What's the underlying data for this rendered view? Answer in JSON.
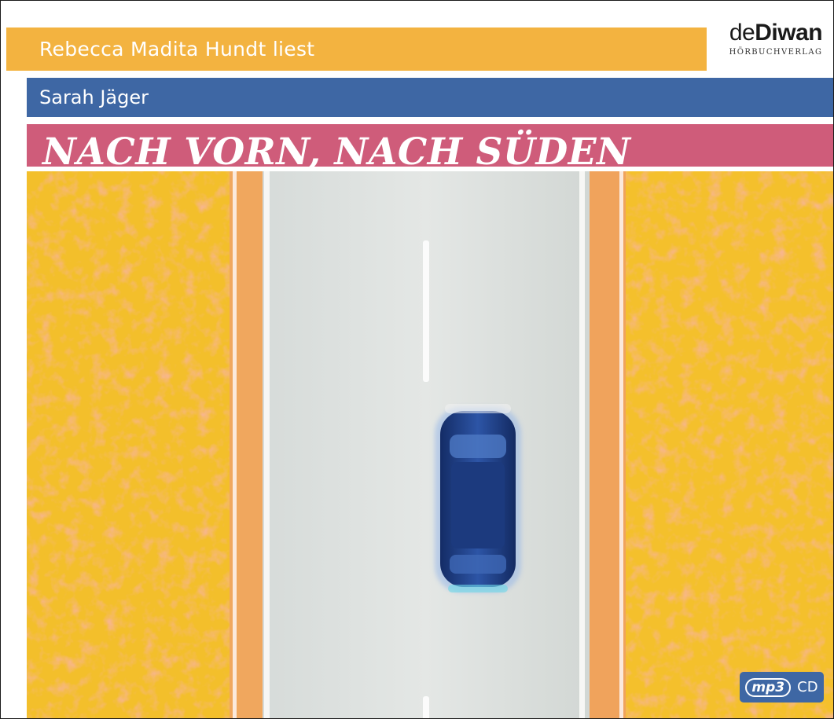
{
  "cover": {
    "narrator_line": "Rebecca Madita Hundt liest",
    "author": "Sarah Jäger",
    "title": "NACH VORN, NACH SÜDEN"
  },
  "publisher": {
    "logo_text_light": "de",
    "logo_text_bold": "Diwan",
    "logo_subtitle": "HÖRBUCHVERLAG"
  },
  "format_badge": {
    "mp3_label": "mp3",
    "cd_label": "CD"
  },
  "colors": {
    "narrator_band": "#f3b340",
    "author_band": "#3e67a4",
    "title_band": "#cf5c7a",
    "field": "#f3bf2b",
    "road": "#dfe3e1",
    "car": "#1f3f86"
  },
  "illustration": {
    "subject": "aerial-road-with-blue-car-icon"
  }
}
